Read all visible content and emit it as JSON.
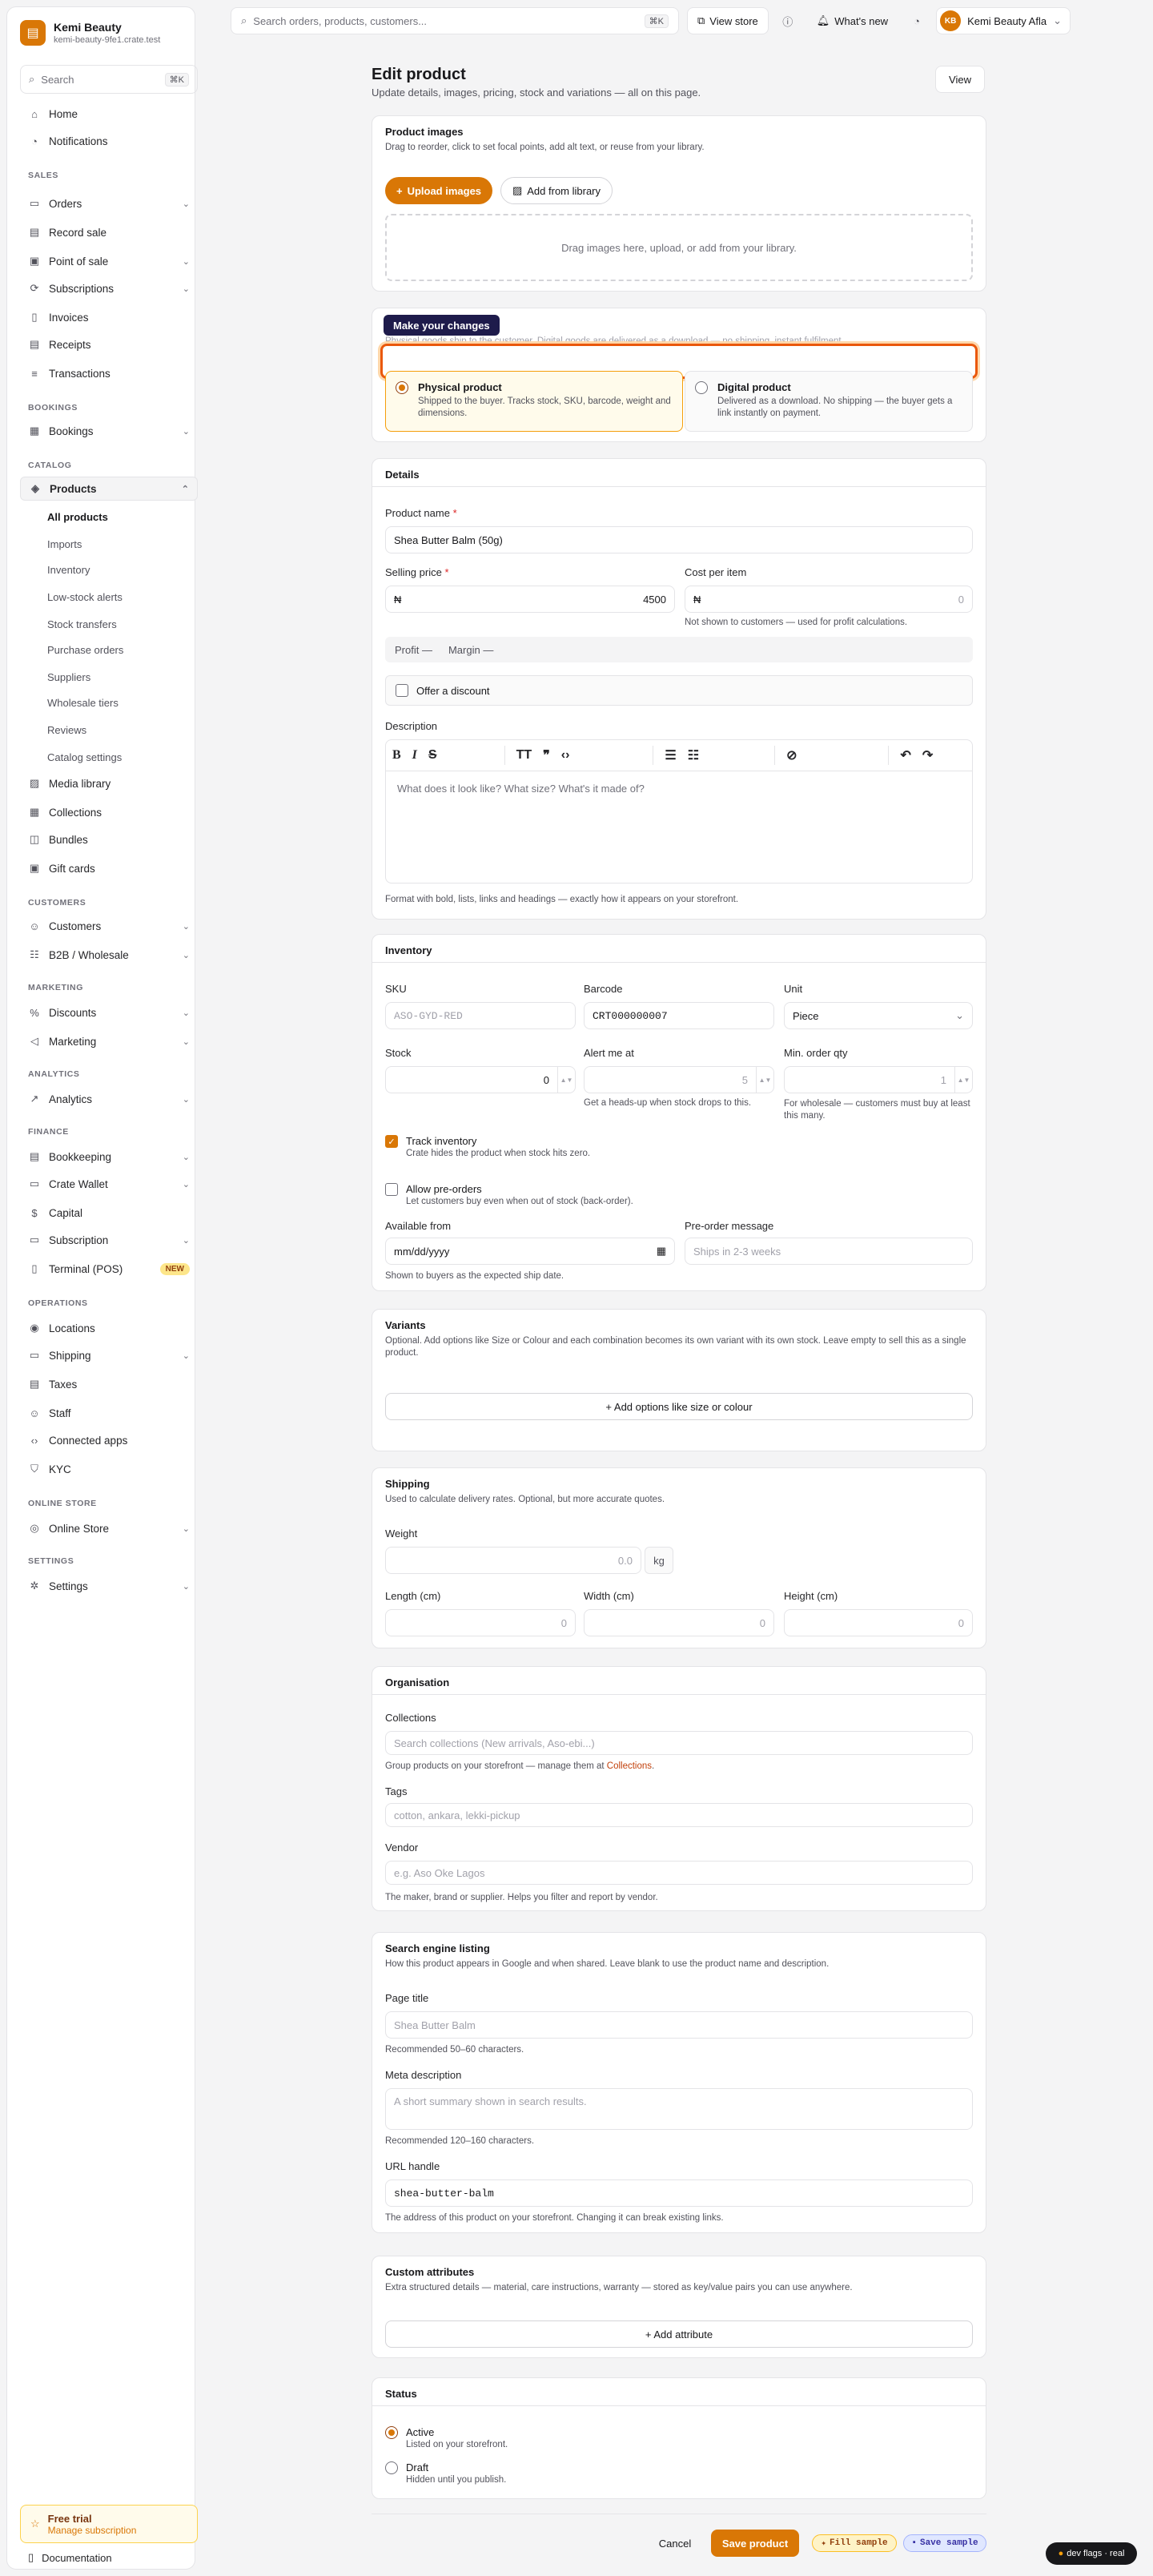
{
  "brand": {
    "name": "Kemi Beauty",
    "url": "kemi-beauty-9fe1.crate.test"
  },
  "sidebar": {
    "search_placeholder": "Search",
    "search_kbd": "⌘K",
    "home": "Home",
    "notifications": "Notifications",
    "sec_sales": "SALES",
    "orders": "Orders",
    "record_sale": "Record sale",
    "pos": "Point of sale",
    "subscriptions": "Subscriptions",
    "invoices": "Invoices",
    "receipts": "Receipts",
    "transactions": "Transactions",
    "sec_bookings": "BOOKINGS",
    "bookings": "Bookings",
    "sec_catalog": "CATALOG",
    "products": "Products",
    "sub": [
      "All products",
      "Imports",
      "Inventory",
      "Low-stock alerts",
      "Stock transfers",
      "Purchase orders",
      "Suppliers",
      "Wholesale tiers",
      "Reviews",
      "Catalog settings"
    ],
    "media": "Media library",
    "collections": "Collections",
    "bundles": "Bundles",
    "gift_cards": "Gift cards",
    "sec_customers": "CUSTOMERS",
    "customers": "Customers",
    "b2b": "B2B / Wholesale",
    "sec_marketing": "MARKETING",
    "discounts": "Discounts",
    "marketing": "Marketing",
    "sec_analytics": "ANALYTICS",
    "analytics": "Analytics",
    "sec_finance": "FINANCE",
    "bookkeeping": "Bookkeeping",
    "wallet": "Crate Wallet",
    "capital": "Capital",
    "subscription": "Subscription",
    "terminal": "Terminal (POS)",
    "new_badge": "NEW",
    "sec_operations": "OPERATIONS",
    "locations": "Locations",
    "shipping": "Shipping",
    "taxes": "Taxes",
    "staff": "Staff",
    "apps": "Connected apps",
    "kyc": "KYC",
    "sec_store": "ONLINE STORE",
    "online_store": "Online Store",
    "sec_settings": "SETTINGS",
    "settings": "Settings",
    "trial_title": "Free trial",
    "trial_sub": "Manage subscription",
    "documentation": "Documentation"
  },
  "topbar": {
    "search_placeholder": "Search orders, products, customers...",
    "search_kbd": "⌘K",
    "view_store": "View store",
    "whats_new": "What's new",
    "account": "Kemi Beauty Afla"
  },
  "page": {
    "title": "Edit product",
    "subtitle": "Update details, images, pricing, stock and variations — all on this page.",
    "view": "View"
  },
  "images": {
    "title": "Product images",
    "sub": "Drag to reorder, click to set focal points, add alt text, or reuse from your library.",
    "upload": "Upload images",
    "library": "Add from library",
    "drop": "Drag images here, upload, or add from your library."
  },
  "type": {
    "tooltip": "Make your changes",
    "sub": "Physical goods ship to the customer. Digital goods are delivered as a download — no shipping, instant fulfilment.",
    "physical_title": "Physical product",
    "physical_sub": "Shipped to the buyer. Tracks stock, SKU, barcode, weight and dimensions.",
    "digital_title": "Digital product",
    "digital_sub": "Delivered as a download. No shipping — the buyer gets a link instantly on payment."
  },
  "details": {
    "title": "Details",
    "name_label": "Product name",
    "name_value": "Shea Butter Balm (50g)",
    "price_label": "Selling price",
    "currency": "₦",
    "price_value": "4500",
    "cost_label": "Cost per item",
    "cost_value": "0",
    "cost_hint": "Not shown to customers — used for profit calculations.",
    "profit": "Profit —",
    "margin": "Margin —",
    "discount": "Offer a discount",
    "desc_label": "Description",
    "desc_placeholder": "What does it look like? What size? What's it made of?",
    "desc_hint": "Format with bold, lists, links and headings — exactly how it appears on your storefront."
  },
  "inventory": {
    "title": "Inventory",
    "sku_label": "SKU",
    "sku_ph": "ASO-GYD-RED",
    "barcode_label": "Barcode",
    "barcode_value": "CRT000000007",
    "unit_label": "Unit",
    "unit_value": "Piece",
    "stock_label": "Stock",
    "stock_value": "0",
    "alert_label": "Alert me at",
    "alert_value": "5",
    "alert_hint": "Get a heads-up when stock drops to this.",
    "min_label": "Min. order qty",
    "min_value": "1",
    "min_hint": "For wholesale — customers must buy at least this many.",
    "track_title": "Track inventory",
    "track_sub": "Crate hides the product when stock hits zero.",
    "pre_title": "Allow pre-orders",
    "pre_sub": "Let customers buy even when out of stock (back-order).",
    "avail_label": "Available from",
    "avail_ph": "mm/dd/yyyy",
    "pre_msg_label": "Pre-order message",
    "pre_msg_ph": "Ships in 2-3 weeks",
    "avail_hint": "Shown to buyers as the expected ship date."
  },
  "variants": {
    "title": "Variants",
    "sub": "Optional. Add options like Size or Colour and each combination becomes its own variant with its own stock. Leave empty to sell this as a single product.",
    "add": "+ Add options like size or colour"
  },
  "shipping": {
    "title": "Shipping",
    "sub": "Used to calculate delivery rates. Optional, but more accurate quotes.",
    "weight_label": "Weight",
    "weight_value": "0.0",
    "weight_unit": "kg",
    "length_label": "Length (cm)",
    "width_label": "Width (cm)",
    "height_label": "Height (cm)",
    "zero": "0"
  },
  "org": {
    "title": "Organisation",
    "coll_label": "Collections",
    "coll_ph": "Search collections (New arrivals, Aso-ebi...)",
    "coll_hint_pre": "Group products on your storefront — manage them at ",
    "coll_hint_link": "Collections",
    "tags_label": "Tags",
    "tags_ph": "cotton, ankara, lekki-pickup",
    "vendor_label": "Vendor",
    "vendor_ph": "e.g. Aso Oke Lagos",
    "vendor_hint": "The maker, brand or supplier. Helps you filter and report by vendor."
  },
  "seo": {
    "title": "Search engine listing",
    "sub": "How this product appears in Google and when shared. Leave blank to use the product name and description.",
    "page_title_label": "Page title",
    "page_title_ph": "Shea Butter Balm",
    "page_title_hint": "Recommended 50–60 characters.",
    "meta_label": "Meta description",
    "meta_ph": "A short summary shown in search results.",
    "meta_hint": "Recommended 120–160 characters.",
    "handle_label": "URL handle",
    "handle_value": "shea-butter-balm",
    "handle_hint": "The address of this product on your storefront. Changing it can break existing links."
  },
  "custom": {
    "title": "Custom attributes",
    "sub": "Extra structured details — material, care instructions, warranty — stored as key/value pairs you can use anywhere.",
    "add": "+ Add attribute"
  },
  "status": {
    "title": "Status",
    "active": "Active",
    "active_sub": "Listed on your storefront.",
    "draft": "Draft",
    "draft_sub": "Hidden until you publish."
  },
  "footer": {
    "cancel": "Cancel",
    "save": "Save product",
    "fill": "Fill sample",
    "save_sample": "Save sample",
    "dev": "dev flags · real"
  },
  "colors": {
    "accent": "#d97706",
    "focus": "#ea580c"
  }
}
